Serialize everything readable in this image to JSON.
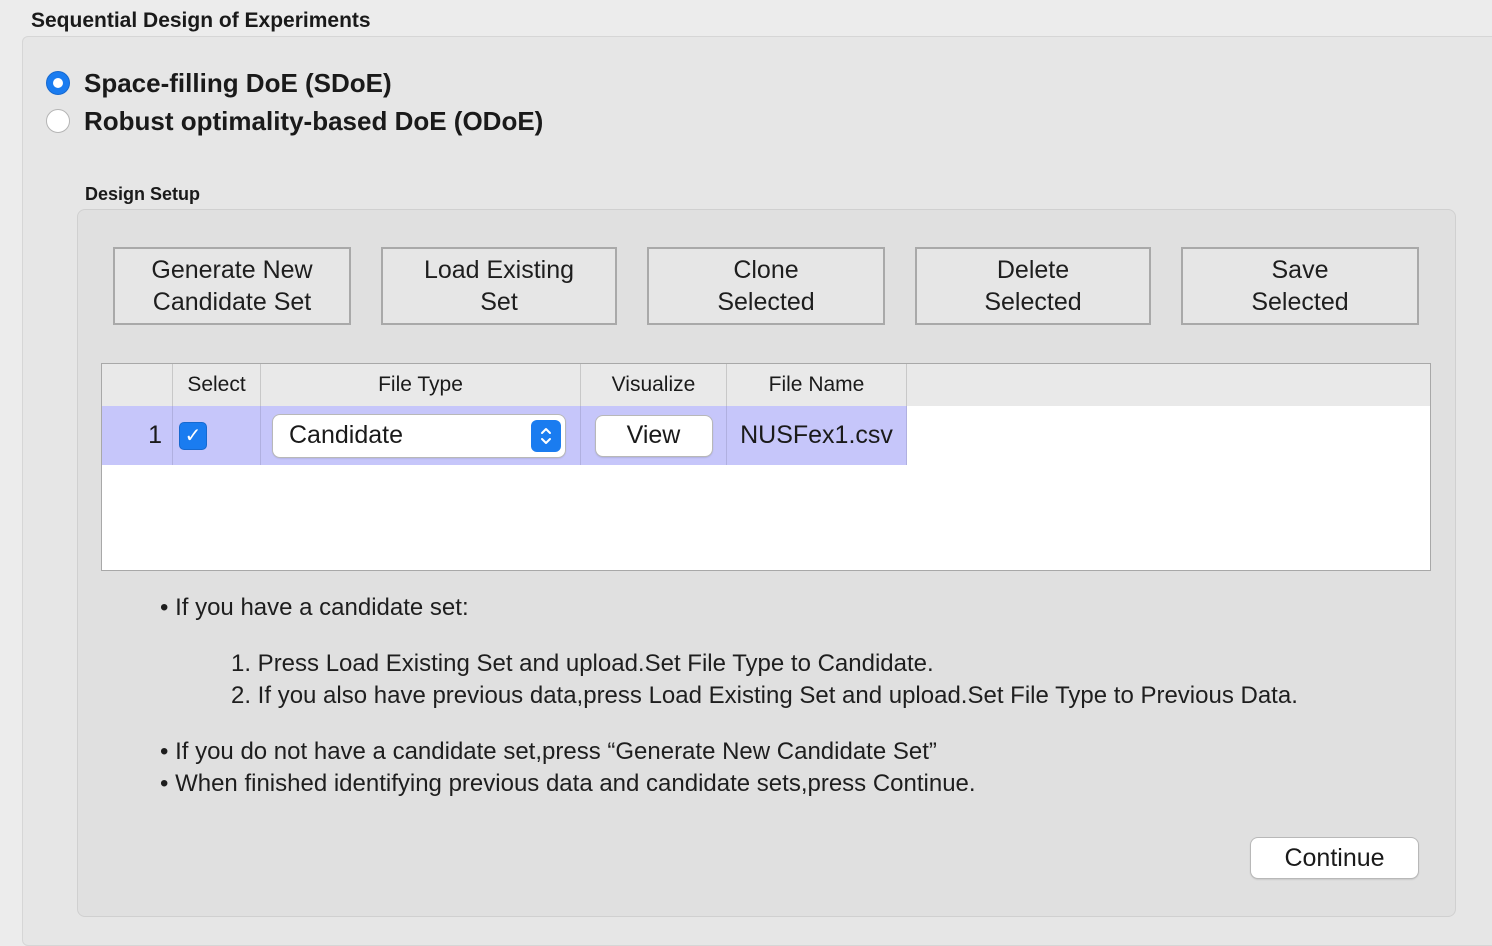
{
  "group_title": "Sequential Design of Experiments",
  "doe_options": [
    {
      "label": "Space-filling DoE (SDoE)",
      "selected": true
    },
    {
      "label": "Robust optimality-based DoE (ODoE)",
      "selected": false
    }
  ],
  "design_setup": {
    "title": "Design Setup",
    "toolbar": {
      "generate": {
        "line1": "Generate New",
        "line2": "Candidate Set"
      },
      "load": {
        "line1": "Load Existing",
        "line2": "Set"
      },
      "clone": {
        "line1": "Clone",
        "line2": "Selected"
      },
      "delete": {
        "line1": "Delete",
        "line2": "Selected"
      },
      "save": {
        "line1": "Save",
        "line2": "Selected"
      }
    },
    "table": {
      "columns": [
        "",
        "Select",
        "File Type",
        "Visualize",
        "File Name"
      ],
      "rows": [
        {
          "index": "1",
          "selected": true,
          "file_type": "Candidate",
          "visualize": "View",
          "file_name": "NUSFex1.csv"
        }
      ]
    },
    "instructions": {
      "bullet1": "If you have a candidate set:",
      "step1": "1. Press Load Existing Set and upload.Set File Type to Candidate.",
      "step2": "2. If you also have previous data,press Load Existing Set and upload.Set File Type to Previous Data.",
      "bullet2": "If you do not have a candidate set,press “Generate New Candidate Set”",
      "bullet3": "When finished identifying previous data and candidate sets,press Continue."
    },
    "continue_label": "Continue"
  },
  "colors": {
    "accent": "#1a7cf0",
    "row_highlight": "#c6c6fa"
  }
}
